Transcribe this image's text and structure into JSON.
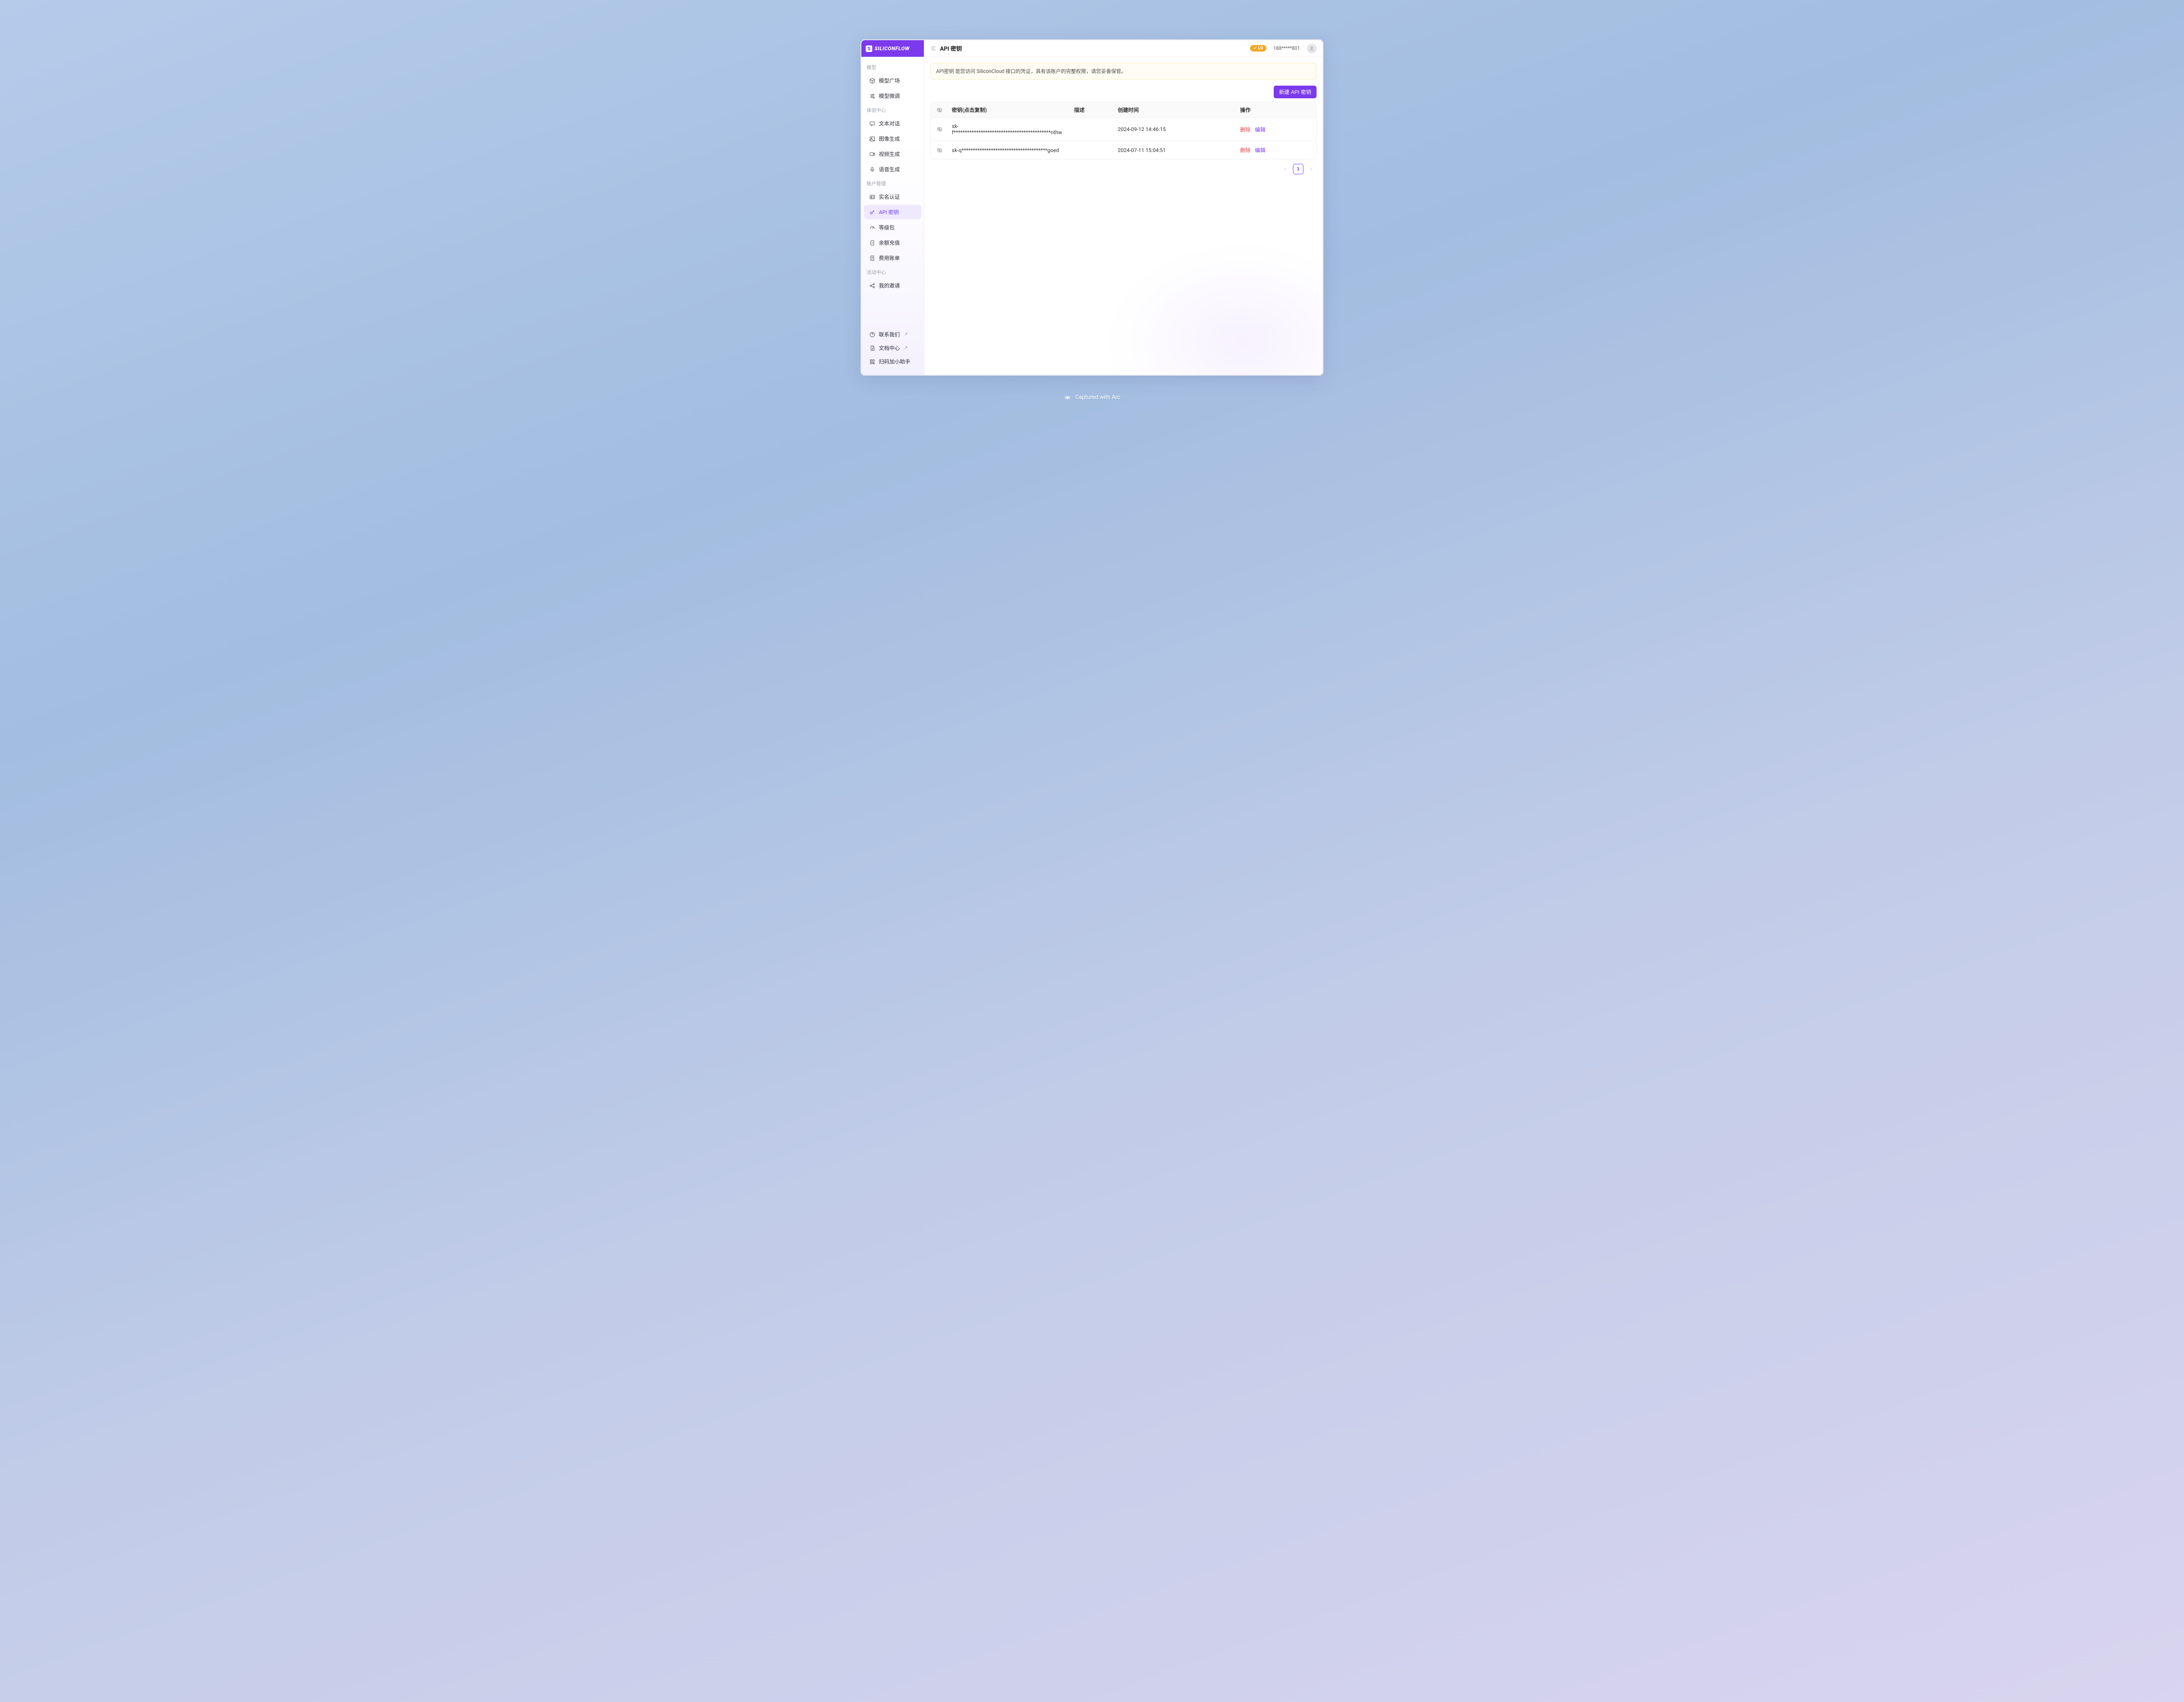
{
  "brand": {
    "mark": "S",
    "name": "SILICONFLOW"
  },
  "sections": {
    "models": {
      "title": "模型",
      "items": [
        {
          "id": "model-plaza",
          "label": "模型广场"
        },
        {
          "id": "model-finetune",
          "label": "模型微调"
        }
      ]
    },
    "experience": {
      "title": "体验中心",
      "items": [
        {
          "id": "text-chat",
          "label": "文本对话"
        },
        {
          "id": "image-gen",
          "label": "图像生成"
        },
        {
          "id": "video-gen",
          "label": "视频生成"
        },
        {
          "id": "voice-gen",
          "label": "语音生成"
        }
      ]
    },
    "account": {
      "title": "账户管理",
      "items": [
        {
          "id": "realname",
          "label": "实名认证"
        },
        {
          "id": "api-keys",
          "label": "API 密钥",
          "active": true
        },
        {
          "id": "tier-pack",
          "label": "等级包"
        },
        {
          "id": "recharge",
          "label": "余额充值"
        },
        {
          "id": "billing",
          "label": "费用账单"
        }
      ]
    },
    "activity": {
      "title": "活动中心",
      "items": [
        {
          "id": "my-invite",
          "label": "我的邀请"
        }
      ]
    }
  },
  "footerLinks": [
    {
      "id": "contact",
      "label": "联系我们",
      "external": true
    },
    {
      "id": "docs",
      "label": "文档中心",
      "external": true
    },
    {
      "id": "qr-helper",
      "label": "扫码加小助手",
      "external": false
    }
  ],
  "header": {
    "pageTitle": "API 密钥",
    "levelBadge": "L0",
    "userPhone": "188*****801"
  },
  "notice": "API密钥 是您访问 SiliconCloud 接口的凭证，具有该账户的完整权限，请您妥善保管。",
  "buttons": {
    "newKey": "新建 API 密钥"
  },
  "table": {
    "columns": {
      "key": "密钥(点击复制)",
      "desc": "描述",
      "created": "创建时间",
      "ops": "操作"
    },
    "ops": {
      "delete": "删除",
      "edit": "编辑"
    },
    "rows": [
      {
        "key": "sk-f*******************************************nthw",
        "desc": "",
        "created": "2024-09-12 14:46:15"
      },
      {
        "key": "sk-q**************************************goed",
        "desc": "",
        "created": "2024-07-11 15:04:51"
      }
    ]
  },
  "pagination": {
    "current": "1"
  },
  "captured": "Captured with Arc"
}
